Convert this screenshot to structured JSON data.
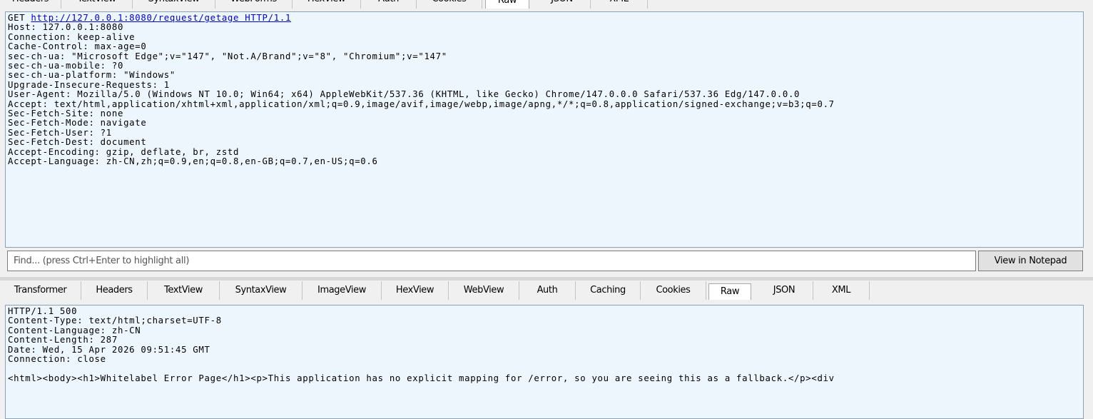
{
  "request_tabs": [
    "Headers",
    "TextView",
    "SyntaxView",
    "WebForms",
    "HexView",
    "Auth",
    "Cookies",
    "Raw",
    "JSON",
    "XML"
  ],
  "request": {
    "method": "GET",
    "url": "http://127.0.0.1:8080/request/getage HTTP/1.1",
    "headers": "Host: 127.0.0.1:8080\nConnection: keep-alive\nCache-Control: max-age=0\nsec-ch-ua: \"Microsoft Edge\";v=\"147\", \"Not.A/Brand\";v=\"8\", \"Chromium\";v=\"147\"\nsec-ch-ua-mobile: ?0\nsec-ch-ua-platform: \"Windows\"\nUpgrade-Insecure-Requests: 1\nUser-Agent: Mozilla/5.0 (Windows NT 10.0; Win64; x64) AppleWebKit/537.36 (KHTML, like Gecko) Chrome/147.0.0.0 Safari/537.36 Edg/147.0.0.0\nAccept: text/html,application/xhtml+xml,application/xml;q=0.9,image/avif,image/webp,image/apng,*/*;q=0.8,application/signed-exchange;v=b3;q=0.7\nSec-Fetch-Site: none\nSec-Fetch-Mode: navigate\nSec-Fetch-User: ?1\nSec-Fetch-Dest: document\nAccept-Encoding: gzip, deflate, br, zstd\nAccept-Language: zh-CN,zh;q=0.9,en;q=0.8,en-GB;q=0.7,en-US;q=0.6"
  },
  "find": {
    "placeholder": "Find... (press Ctrl+Enter to highlight all)",
    "view_button": "View in Notepad"
  },
  "response_tabs": [
    {
      "label": "Transformer"
    },
    {
      "label": "Headers"
    },
    {
      "label": "TextView"
    },
    {
      "label": "SyntaxView"
    },
    {
      "label": "ImageView"
    },
    {
      "label": "HexView"
    },
    {
      "label": "WebView"
    },
    {
      "label": "Auth"
    },
    {
      "label": "Caching"
    },
    {
      "label": "Cookies"
    },
    {
      "label": "Raw"
    },
    {
      "label": "JSON"
    },
    {
      "label": "XML"
    }
  ],
  "response": {
    "text": "HTTP/1.1 500\nContent-Type: text/html;charset=UTF-8\nContent-Language: zh-CN\nContent-Length: 287\nDate: Wed, 15 Apr 2026 09:51:45 GMT\nConnection: close\n\n<html><body><h1>Whitelabel Error Page</h1><p>This application has no explicit mapping for /error, so you are seeing this as a fallback.</p><div"
  },
  "active_tab": "Raw"
}
